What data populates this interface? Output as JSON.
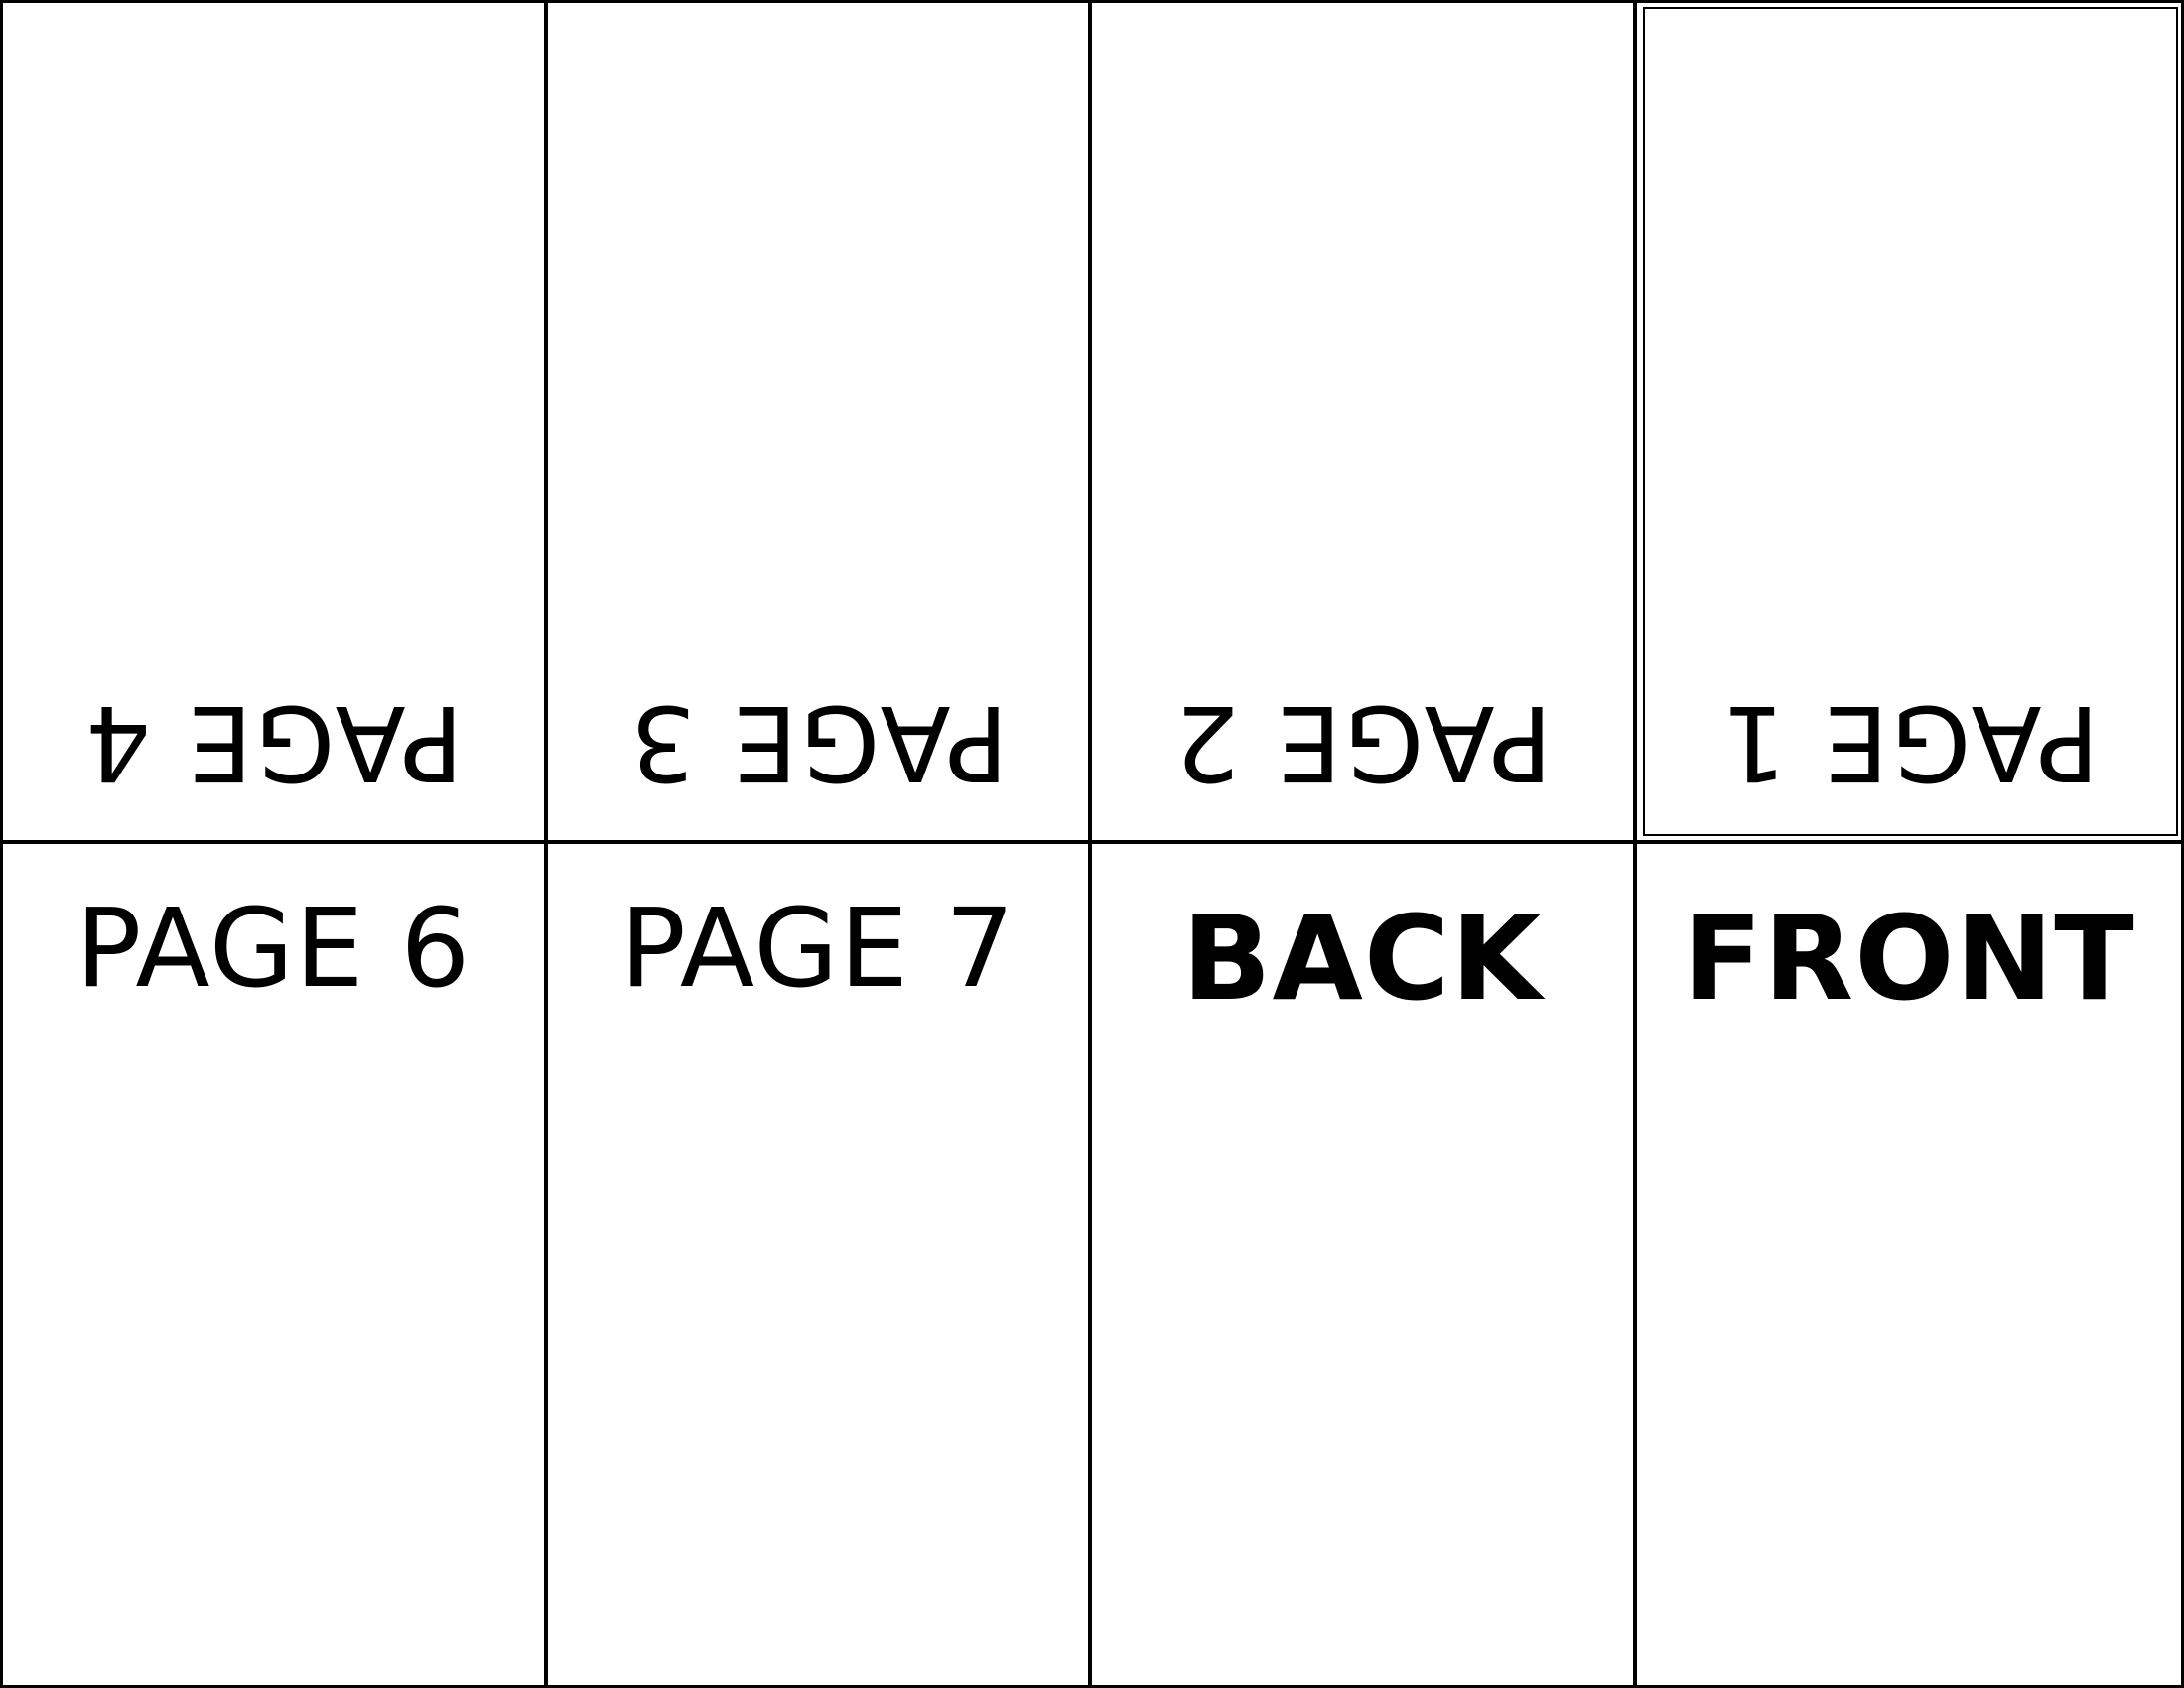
{
  "top_row": [
    {
      "label": "PAGE 4"
    },
    {
      "label": "PAGE 3"
    },
    {
      "label": "PAGE 2"
    },
    {
      "label": "PAGE 1"
    }
  ],
  "bottom_row": [
    {
      "label": "PAGE 6"
    },
    {
      "label": "PAGE 7"
    },
    {
      "label": "BACK"
    },
    {
      "label": "FRONT"
    }
  ],
  "orientation": {
    "top_row": "upside-down",
    "bottom_row": "upright"
  },
  "colors": {
    "ink": "#000000",
    "paper": "#ffffff"
  }
}
